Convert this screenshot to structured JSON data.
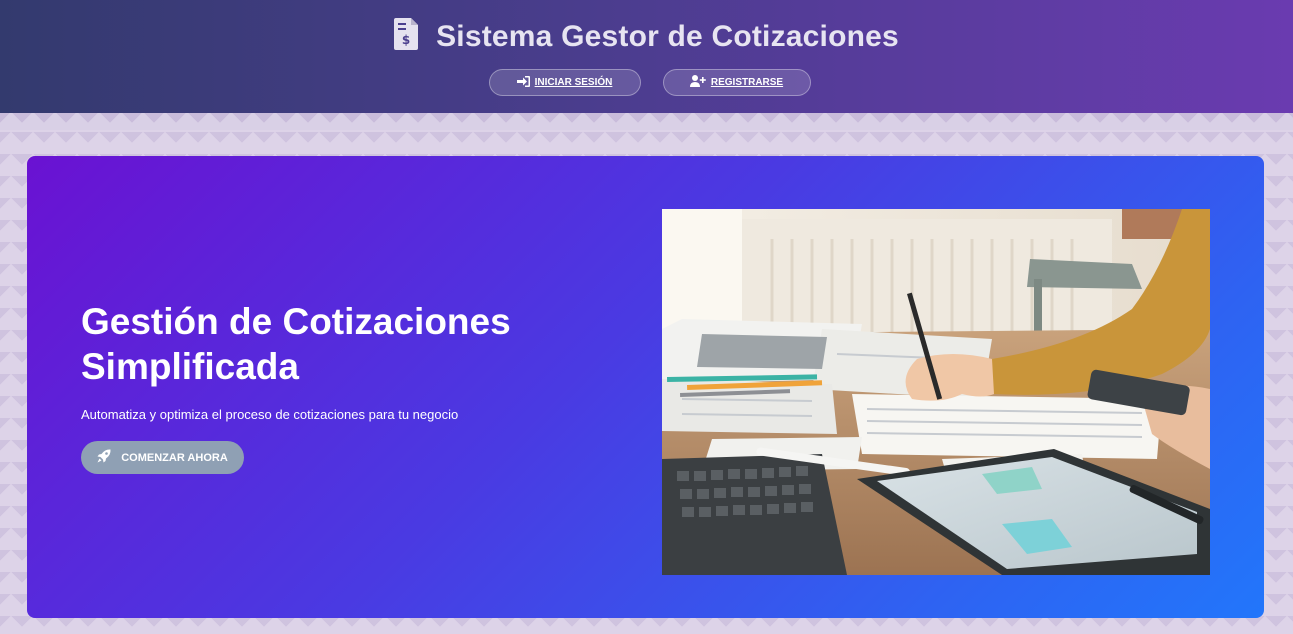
{
  "header": {
    "title": "Sistema Gestor de Cotizaciones",
    "title_icon": "file-invoice-dollar-icon",
    "buttons": {
      "login_label": "INICIAR SESIÓN",
      "login_icon": "sign-in-icon",
      "register_label": "REGISTRARSE",
      "register_icon": "user-plus-icon"
    }
  },
  "hero": {
    "heading": "Gestión de Cotizaciones Simplificada",
    "subtitle": "Automatiza y optimiza el proceso de cotizaciones para tu negocio",
    "cta_label": "COMENZAR AHORA",
    "cta_icon": "rocket-icon",
    "image_description_icon": "workspace-photo"
  },
  "colors": {
    "header_start": "#333a6e",
    "header_end": "#6a3bb0",
    "hero_start": "#6a12d2",
    "hero_end": "#2276fb",
    "cta_bg": "#8fa0b4"
  }
}
